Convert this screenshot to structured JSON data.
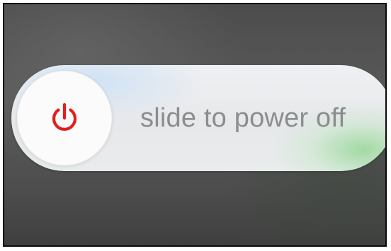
{
  "power_slider": {
    "label": "slide to power off",
    "icon": "power-icon",
    "icon_color": "#e0201e",
    "label_color": "#8b8d90"
  }
}
